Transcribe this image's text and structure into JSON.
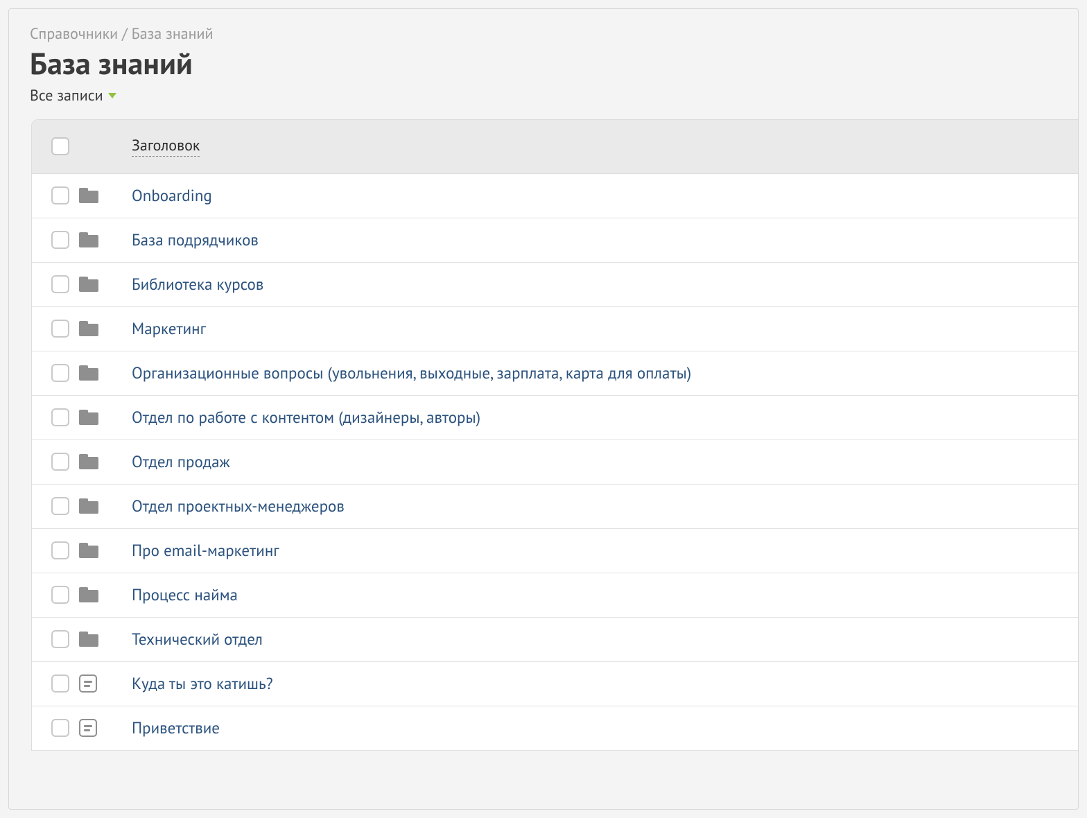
{
  "breadcrumb": "Справочники / База знаний",
  "title": "База знаний",
  "filter_label": "Все записи",
  "table": {
    "column_title": "Заголовок",
    "rows": [
      {
        "type": "folder",
        "title": "Onboarding"
      },
      {
        "type": "folder",
        "title": "База подрядчиков"
      },
      {
        "type": "folder",
        "title": "Библиотека курсов"
      },
      {
        "type": "folder",
        "title": "Маркетинг"
      },
      {
        "type": "folder",
        "title": "Организационные вопросы (увольнения, выходные, зарплата, карта для оплаты)"
      },
      {
        "type": "folder",
        "title": "Отдел по работе с контентом (дизайнеры, авторы)"
      },
      {
        "type": "folder",
        "title": "Отдел продаж"
      },
      {
        "type": "folder",
        "title": "Отдел проектных-менеджеров"
      },
      {
        "type": "folder",
        "title": "Про email-маркетинг"
      },
      {
        "type": "folder",
        "title": "Процесс найма"
      },
      {
        "type": "folder",
        "title": "Технический отдел"
      },
      {
        "type": "doc",
        "title": "Куда ты это катишь?"
      },
      {
        "type": "doc",
        "title": "Приветствие"
      }
    ]
  }
}
